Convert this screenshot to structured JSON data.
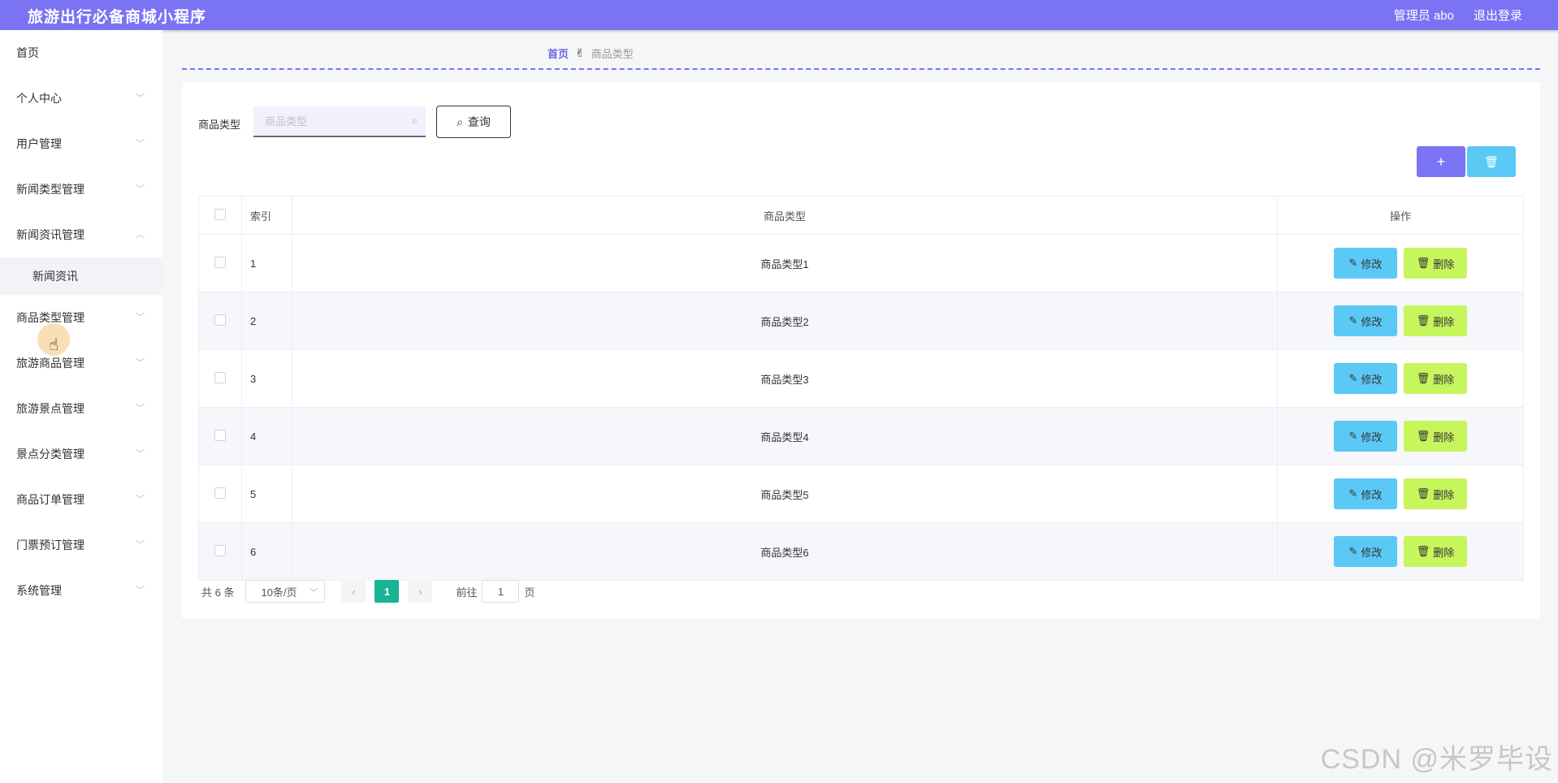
{
  "header": {
    "title": "旅游出行必备商城小程序",
    "user": "管理员 abo",
    "logout": "退出登录"
  },
  "sidebar": {
    "items": [
      {
        "label": "首页"
      },
      {
        "label": "个人中心"
      },
      {
        "label": "用户管理"
      },
      {
        "label": "新闻类型管理"
      },
      {
        "label": "新闻资讯管理"
      },
      {
        "label": "新闻资讯"
      },
      {
        "label": "商品类型管理"
      },
      {
        "label": "旅游商品管理"
      },
      {
        "label": "旅游景点管理"
      },
      {
        "label": "景点分类管理"
      },
      {
        "label": "商品订单管理"
      },
      {
        "label": "门票预订管理"
      },
      {
        "label": "系统管理"
      }
    ]
  },
  "breadcrumb": {
    "home": "首页",
    "current": "商品类型"
  },
  "search": {
    "label": "商品类型",
    "placeholder": "商品类型",
    "button": "查询"
  },
  "actions": {
    "add": "+",
    "delete": "🗑"
  },
  "table": {
    "headers": {
      "index": "索引",
      "type": "商品类型",
      "ops": "操作"
    },
    "edit_label": "修改",
    "delete_label": "删除",
    "rows": [
      {
        "index": "1",
        "type": "商品类型1"
      },
      {
        "index": "2",
        "type": "商品类型2"
      },
      {
        "index": "3",
        "type": "商品类型3"
      },
      {
        "index": "4",
        "type": "商品类型4"
      },
      {
        "index": "5",
        "type": "商品类型5"
      },
      {
        "index": "6",
        "type": "商品类型6"
      }
    ]
  },
  "pagination": {
    "total": "共 6 条",
    "page_size": "10条/页",
    "current_page": "1",
    "goto_label": "前往",
    "goto_value": "1",
    "page_suffix": "页"
  },
  "watermark": "CSDN @米罗毕设",
  "colors": {
    "primary": "#7a73f4",
    "edit": "#5bc9f6",
    "delete": "#c6f55c",
    "page_active": "#1ab394"
  }
}
